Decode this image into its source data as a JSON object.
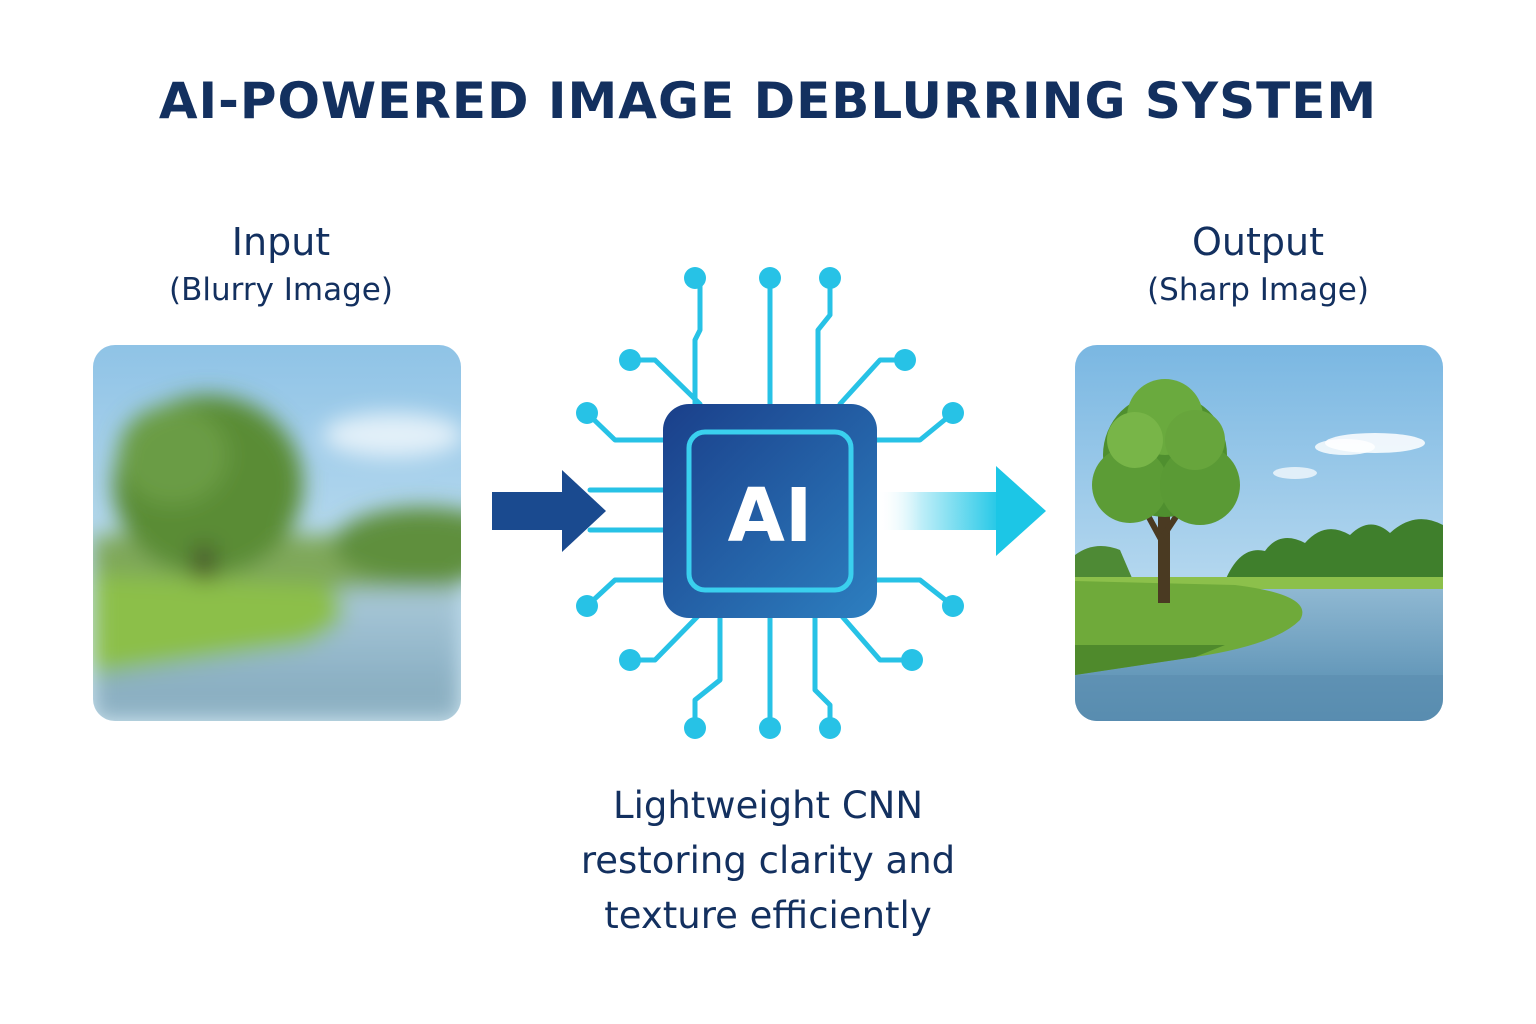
{
  "title": "AI-POWERED IMAGE DEBLURRING SYSTEM",
  "input": {
    "label": "Input",
    "sublabel": "(Blurry Image)"
  },
  "output": {
    "label": "Output",
    "sublabel": "(Sharp Image)"
  },
  "chip": {
    "text": "AI"
  },
  "caption": {
    "line1": "Lightweight CNN",
    "line2": "restoring clarity and",
    "line3": "texture efficiently"
  },
  "colors": {
    "title": "#13305f",
    "chip_dark": "#1a3f8a",
    "chip_light": "#2d7fc0",
    "circuit": "#27c2e6",
    "arrow_in": "#1a4a8f",
    "arrow_out": "#1cc6e6"
  }
}
